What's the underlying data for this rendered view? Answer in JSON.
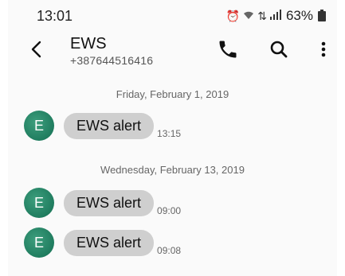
{
  "status_bar": {
    "time": "13:01",
    "icons": [
      "alarm-icon",
      "wifi-icon",
      "data-arrows-icon",
      "signal-icon"
    ],
    "battery_percent": "63%"
  },
  "header": {
    "contact_name": "EWS",
    "contact_number": "+387644516416"
  },
  "conversation": {
    "groups": [
      {
        "date": "Friday, February 1, 2019",
        "messages": [
          {
            "avatar_letter": "E",
            "text": "EWS alert",
            "time": "13:15"
          }
        ]
      },
      {
        "date": "Wednesday, February 13, 2019",
        "messages": [
          {
            "avatar_letter": "E",
            "text": "EWS alert",
            "time": "09:00"
          },
          {
            "avatar_letter": "E",
            "text": "EWS alert",
            "time": "09:08"
          }
        ]
      }
    ]
  },
  "colors": {
    "avatar": "#1f7d5f",
    "bubble": "#cfcfcf",
    "background": "#fafafa"
  }
}
